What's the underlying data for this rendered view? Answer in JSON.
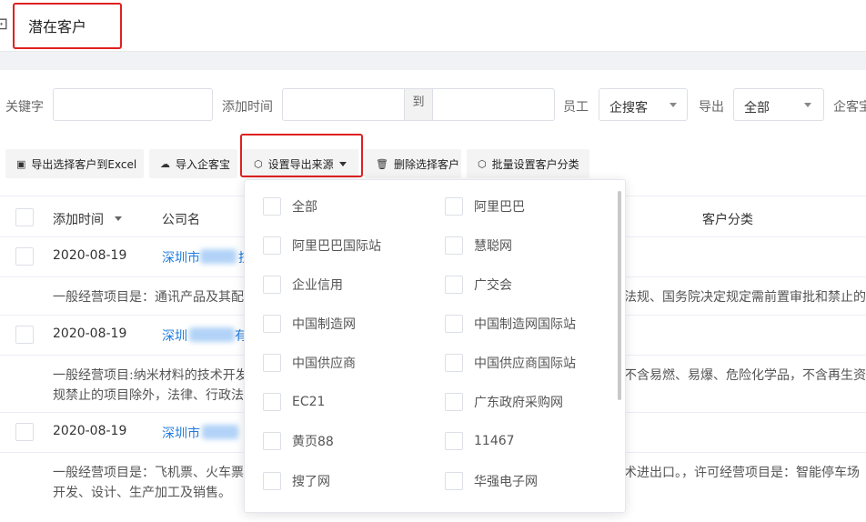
{
  "header": {
    "title": "潜在客户",
    "toggle_icon": "⊡"
  },
  "filters": {
    "keyword_label": "关键字",
    "add_time_label": "添加时间",
    "date_separator": "到",
    "employee_label": "员工",
    "employee_value": "企搜客",
    "export_label": "导出",
    "export_value": "全部",
    "qikebao_label": "企客宝"
  },
  "toolbar": {
    "export_excel": "导出选择客户到Excel",
    "import_qikebao": "导入企客宝",
    "set_export_source": "设置导出来源",
    "delete_selected": "删除选择客户",
    "batch_category": "批量设置客户分类"
  },
  "table": {
    "headers": {
      "add_time": "添加时间",
      "company": "公司名",
      "category": "客户分类"
    },
    "rows": [
      {
        "date": "2020-08-19",
        "company_prefix": "深圳市",
        "company_suffix": "技",
        "desc_left": "一般经营项目是：通讯产品及其配",
        "desc_right": "法规、国务院决定规定需前置审批和禁止的"
      },
      {
        "date": "2020-08-19",
        "company_prefix": "深圳",
        "company_suffix": "有",
        "desc_left": "一般经营项目:纳米材料的技术开发",
        "desc_right": "不含易燃、易爆、危险化学品，不含再生资源",
        "desc_left2": "规禁止的项目除外，法律、行政法"
      },
      {
        "date": "2020-08-19",
        "company_prefix": "深圳市",
        "company_suffix": "",
        "desc_left": "一般经营项目是：飞机票、火车票",
        "desc_right": "术进出口。，许可经营项目是：智能停车场",
        "desc_left2": "开发、设计、生产加工及销售。"
      }
    ]
  },
  "dropdown": {
    "options_left": [
      "全部",
      "阿里巴巴国际站",
      "企业信用",
      "中国制造网",
      "中国供应商",
      "EC21",
      "黄页88",
      "搜了网"
    ],
    "options_right": [
      "阿里巴巴",
      "慧聪网",
      "广交会",
      "中国制造网国际站",
      "中国供应商国际站",
      "广东政府采购网",
      "11467",
      "华强电子网"
    ]
  },
  "colors": {
    "link": "#1e7be0",
    "highlight": "#e02020"
  }
}
